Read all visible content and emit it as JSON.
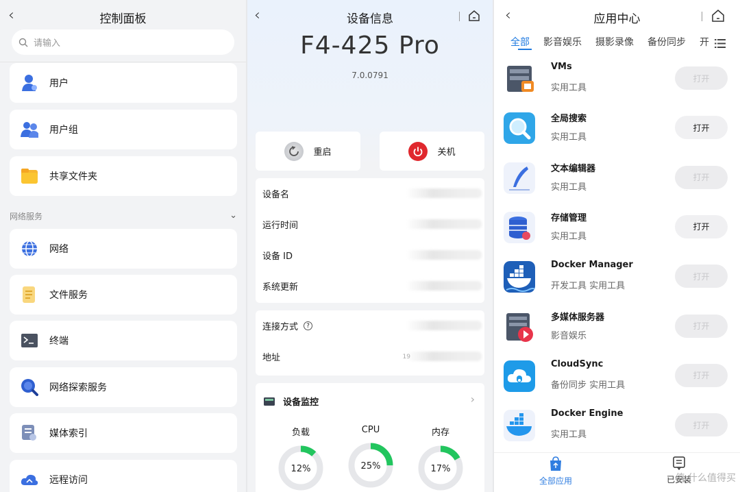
{
  "panel1": {
    "title": "控制面板",
    "search_placeholder": "请输入",
    "items_top": [
      {
        "label": "用户",
        "icon": "user-icon"
      },
      {
        "label": "用户组",
        "icon": "user-group-icon"
      },
      {
        "label": "共享文件夹",
        "icon": "folder-icon"
      }
    ],
    "section_label": "网络服务",
    "items_net": [
      {
        "label": "网络",
        "icon": "globe-icon"
      },
      {
        "label": "文件服务",
        "icon": "file-service-icon"
      },
      {
        "label": "终端",
        "icon": "terminal-icon"
      },
      {
        "label": "网络探索服务",
        "icon": "discovery-icon"
      },
      {
        "label": "媒体索引",
        "icon": "media-index-icon"
      },
      {
        "label": "远程访问",
        "icon": "cloud-remote-icon"
      }
    ]
  },
  "panel2": {
    "title": "设备信息",
    "device_name": "F4-425 Pro",
    "version": "7.0.0791",
    "restart_label": "重启",
    "shutdown_label": "关机",
    "info_rows": [
      "设备名",
      "运行时间",
      "设备 ID",
      "系统更新"
    ],
    "conn_rows": [
      "连接方式",
      "地址"
    ],
    "addr_prefix": "19",
    "monitor_title": "设备监控",
    "gauges": [
      {
        "label": "负载",
        "value": "12%",
        "fraction": 0.12
      },
      {
        "label": "CPU",
        "value": "25%",
        "fraction": 0.25
      },
      {
        "label": "内存",
        "value": "17%",
        "fraction": 0.17
      }
    ],
    "accent": "#22c55e"
  },
  "panel3": {
    "title": "应用中心",
    "tabs": [
      "全部",
      "影音娱乐",
      "摄影录像",
      "备份同步",
      "开"
    ],
    "active_tab": 0,
    "accent": "#1f7ae0",
    "apps": [
      {
        "name": "VMs",
        "category": "实用工具",
        "open": "打开",
        "enabled": false,
        "icon": "vms-icon"
      },
      {
        "name": "全局搜索",
        "category": "实用工具",
        "open": "打开",
        "enabled": true,
        "icon": "global-search-icon"
      },
      {
        "name": "文本编辑器",
        "category": "实用工具",
        "open": "打开",
        "enabled": false,
        "icon": "text-editor-icon"
      },
      {
        "name": "存储管理",
        "category": "实用工具",
        "open": "打开",
        "enabled": true,
        "icon": "storage-icon"
      },
      {
        "name": "Docker Manager",
        "category": "开发工具 实用工具",
        "open": "打开",
        "enabled": false,
        "icon": "docker-manager-icon"
      },
      {
        "name": "多媒体服务器",
        "category": "影音娱乐",
        "open": "打开",
        "enabled": false,
        "icon": "media-server-icon"
      },
      {
        "name": "CloudSync",
        "category": "备份同步 实用工具",
        "open": "打开",
        "enabled": false,
        "icon": "cloudsync-icon"
      },
      {
        "name": "Docker Engine",
        "category": "实用工具",
        "open": "打开",
        "enabled": false,
        "icon": "docker-engine-icon"
      }
    ],
    "bottom_tabs": [
      {
        "label": "全部应用",
        "icon": "store-icon"
      },
      {
        "label": "已安装",
        "icon": "installed-icon"
      }
    ],
    "watermark": "值 什么值得买"
  }
}
